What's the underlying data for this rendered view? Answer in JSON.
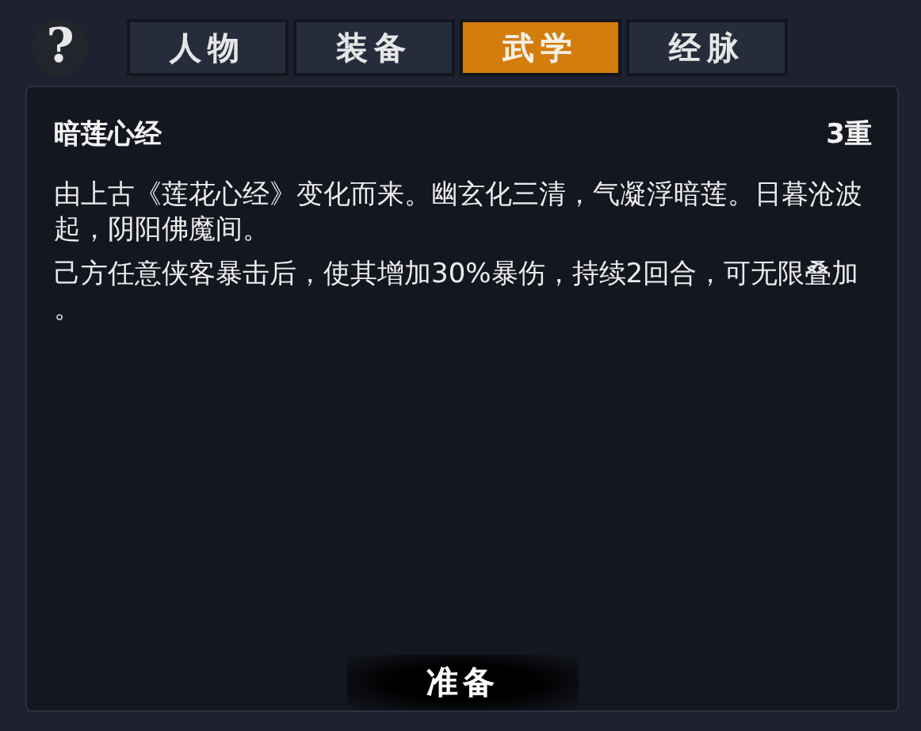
{
  "help_button": {
    "label": "?"
  },
  "tabs": [
    {
      "label": "人物",
      "selected": false
    },
    {
      "label": "装备",
      "selected": false
    },
    {
      "label": "武学",
      "selected": true
    },
    {
      "label": "经脉",
      "selected": false
    }
  ],
  "tooltip": {
    "title": "暗莲心经",
    "level": "3重",
    "paragraphs": [
      "由上古《莲花心经》变化而来。幽玄化三清，气凝浮暗莲。日暮沧波起，阴阳佛魔间。",
      "己方任意侠客暴击后，使其增加30%暴伤，持续2回合，可无限叠加。"
    ]
  },
  "action_button": {
    "label": "准备"
  }
}
